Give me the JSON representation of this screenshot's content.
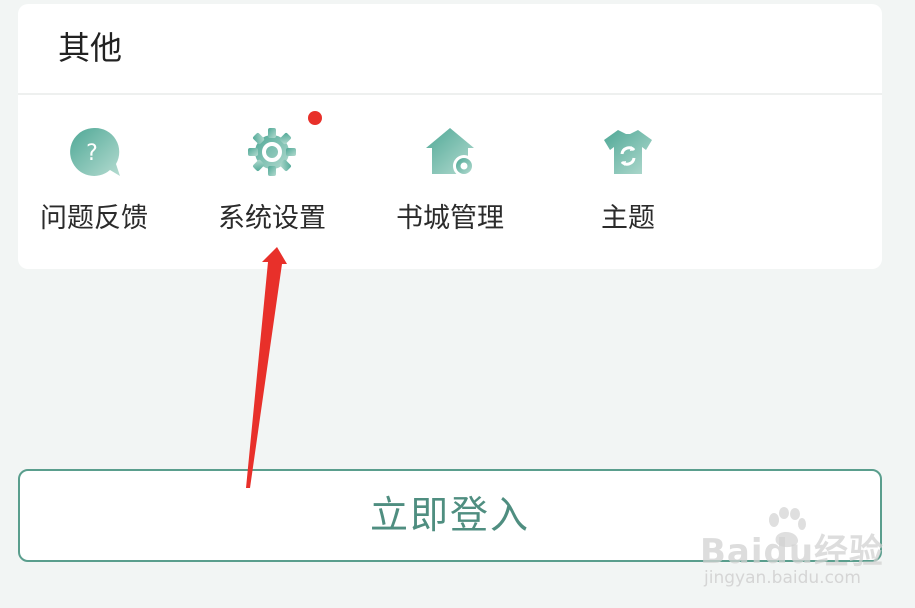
{
  "section": {
    "title": "其他"
  },
  "items": [
    {
      "label": "问题反馈",
      "icon": "feedback-question-icon"
    },
    {
      "label": "系统设置",
      "icon": "gear-icon",
      "badge": true
    },
    {
      "label": "书城管理",
      "icon": "store-settings-icon"
    },
    {
      "label": "主题",
      "icon": "theme-shirt-icon"
    }
  ],
  "login": {
    "label": "立即登入"
  },
  "colors": {
    "icon_gradient_start": "#5fb3a3",
    "icon_gradient_end": "#a8d3c7",
    "badge": "#e8302a",
    "button_border": "#5a9e8d",
    "button_text": "#4f8e80",
    "annotation_arrow": "#e8302a"
  },
  "watermark": {
    "brand": "Baidu经验",
    "url": "jingyan.baidu.com"
  }
}
